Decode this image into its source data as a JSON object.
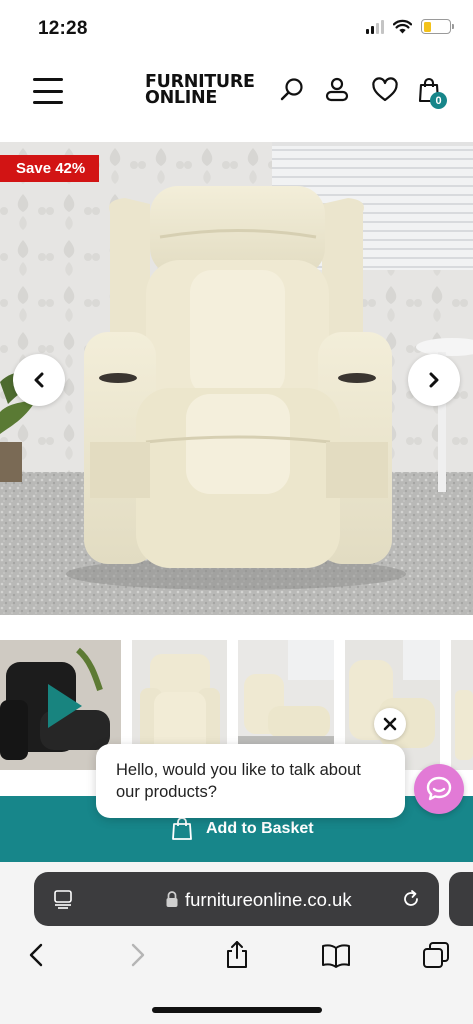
{
  "status_bar": {
    "time": "12:28"
  },
  "header": {
    "logo_line1": "FURNITURE",
    "logo_line2": "ONLINE",
    "icons": [
      "menu-icon",
      "search-icon",
      "account-icon",
      "wishlist-heart-icon",
      "basket-bag-icon"
    ],
    "cart_count": "0"
  },
  "product_gallery": {
    "save_badge": "Save 42%",
    "prev_icon": "chevron-left-icon",
    "next_icon": "chevron-right-icon",
    "thumbnail_video_icon": "play-icon"
  },
  "basket": {
    "label": "Add to Basket",
    "icon": "basket-bag-icon"
  },
  "chat": {
    "message": "Hello, would you like to talk about our products?",
    "close_icon": "close-icon",
    "launcher_icon": "chat-icon"
  },
  "browser": {
    "url": "furnitureonline.co.uk",
    "icons": [
      "page-menu-icon",
      "lock-icon",
      "reload-icon",
      "back-icon",
      "forward-icon",
      "share-icon",
      "bookmarks-icon",
      "tabs-icon"
    ]
  },
  "colors": {
    "accent_teal": "#17868a",
    "save_red": "#d21414",
    "chat_pink": "#e27ad6"
  }
}
